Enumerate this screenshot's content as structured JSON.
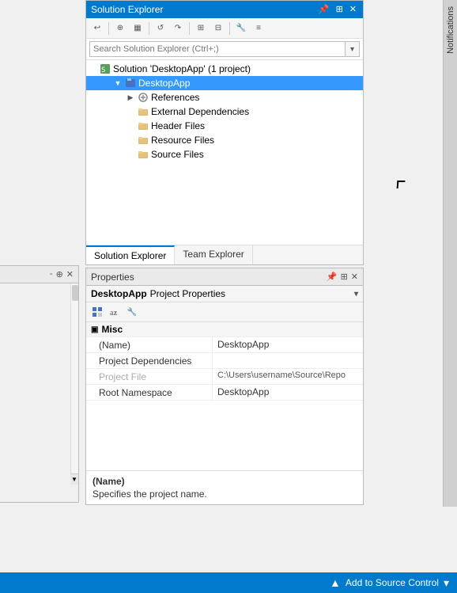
{
  "notifications": {
    "label": "Notifications"
  },
  "solution_explorer": {
    "title": "Solution Explorer",
    "pin_btn": "⊕",
    "close_btn": "✕",
    "toolbar": {
      "buttons": [
        "↩",
        "⊕",
        "▦",
        "↺",
        "↷",
        "⊞",
        "⊟",
        "🔧",
        "⚙",
        "≡"
      ]
    },
    "search_placeholder": "Search Solution Explorer (Ctrl+;)",
    "tree": {
      "solution_label": "Solution 'DesktopApp' (1 project)",
      "project_label": "DesktopApp",
      "references_label": "References",
      "external_deps_label": "External Dependencies",
      "header_files_label": "Header Files",
      "resource_files_label": "Resource Files",
      "source_files_label": "Source Files"
    },
    "tabs": [
      {
        "label": "Solution Explorer",
        "active": true
      },
      {
        "label": "Team Explorer",
        "active": false
      }
    ]
  },
  "properties": {
    "title": "Properties",
    "titlebar_buttons": [
      "▾",
      "⊕",
      "✕"
    ],
    "project_name": "DesktopApp",
    "project_props": "Project Properties",
    "section_misc": "Misc",
    "rows": [
      {
        "name": "(Name)",
        "value": "DesktopApp",
        "grayed": false
      },
      {
        "name": "Project Dependencies",
        "value": "",
        "grayed": false
      },
      {
        "name": "Project File",
        "value": "C:\\Users\\username\\Source\\Repo",
        "grayed": true
      },
      {
        "name": "Root Namespace",
        "value": "DesktopApp",
        "grayed": false
      }
    ],
    "description_title": "(Name)",
    "description_text": "Specifies the project name."
  },
  "status_bar": {
    "add_source_label": "Add to Source Control",
    "up_arrow": "▲",
    "down_arrow": "▾"
  },
  "left_panel": {
    "buttons": [
      "-",
      "⊕",
      "✕"
    ]
  }
}
